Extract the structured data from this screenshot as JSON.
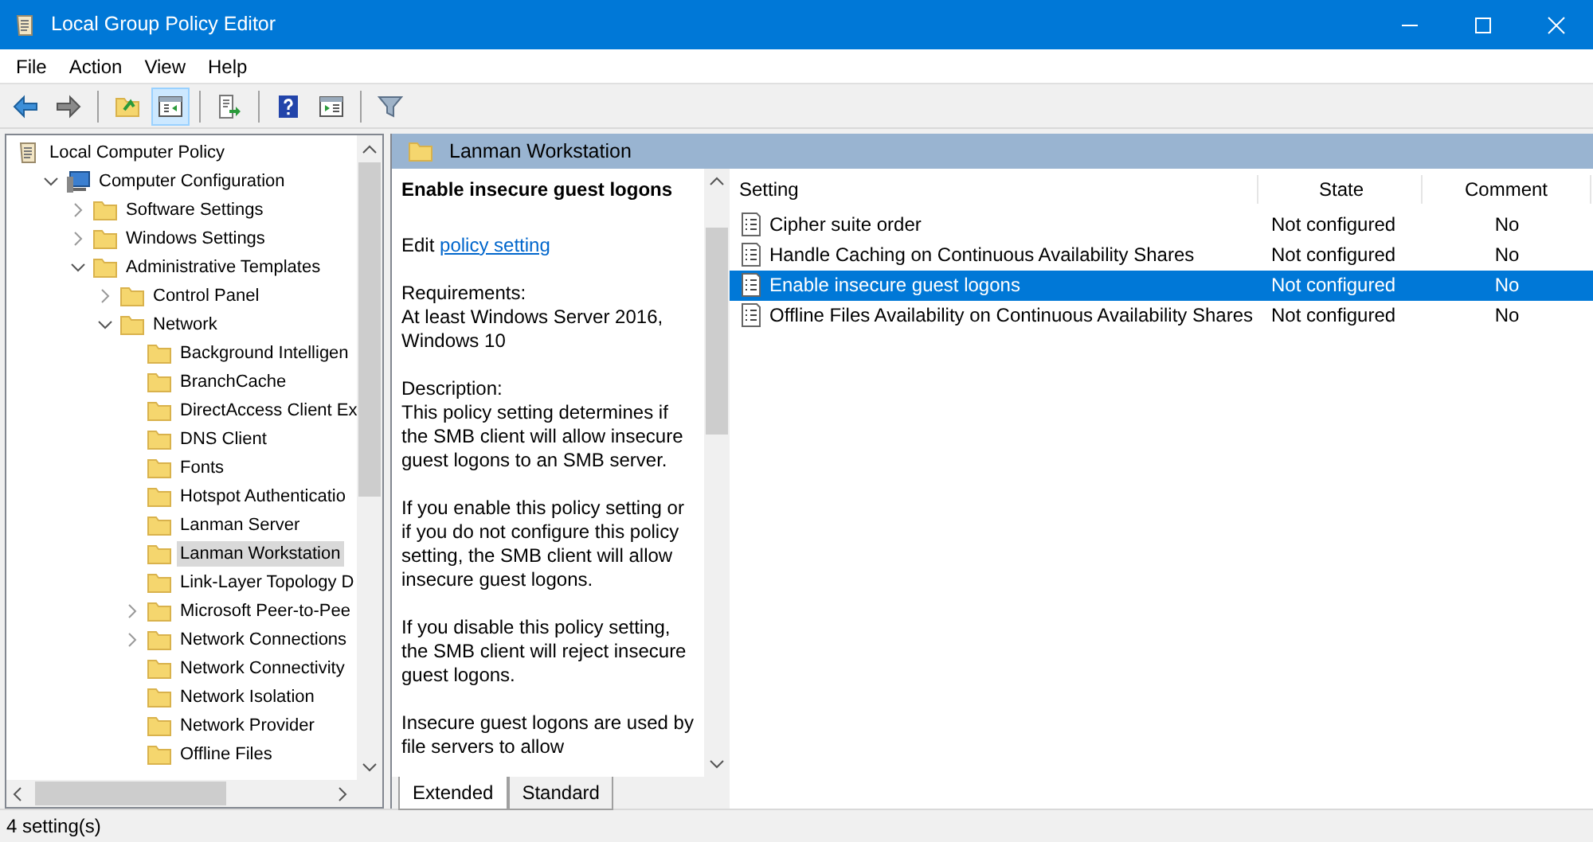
{
  "window": {
    "title": "Local Group Policy Editor"
  },
  "menu": [
    "File",
    "Action",
    "View",
    "Help"
  ],
  "toolbar": [
    {
      "kind": "back",
      "pressed": false
    },
    {
      "kind": "forward",
      "pressed": false
    },
    {
      "kind": "sep"
    },
    {
      "kind": "up",
      "pressed": false
    },
    {
      "kind": "tree",
      "pressed": true
    },
    {
      "kind": "sep"
    },
    {
      "kind": "export",
      "pressed": false
    },
    {
      "kind": "sep"
    },
    {
      "kind": "help",
      "pressed": false
    },
    {
      "kind": "pane",
      "pressed": false
    },
    {
      "kind": "sep"
    },
    {
      "kind": "filter",
      "pressed": false
    }
  ],
  "tree": [
    {
      "label": "Local Computer Policy",
      "kind": "policy",
      "selected": false,
      "children": [
        {
          "label": "Computer Configuration",
          "kind": "computer",
          "expanded": true,
          "selected": false,
          "children": [
            {
              "label": "Software Settings",
              "kind": "folder",
              "expanded": false,
              "selected": false
            },
            {
              "label": "Windows Settings",
              "kind": "folder",
              "expanded": false,
              "selected": false
            },
            {
              "label": "Administrative Templates",
              "kind": "folder",
              "expanded": true,
              "selected": false,
              "children": [
                {
                  "label": "Control Panel",
                  "kind": "folder",
                  "expanded": false,
                  "selected": false
                },
                {
                  "label": "Network",
                  "kind": "folder",
                  "expanded": true,
                  "selected": false,
                  "children": [
                    {
                      "label": "Background Intelligen",
                      "kind": "folder",
                      "selected": false
                    },
                    {
                      "label": "BranchCache",
                      "kind": "folder",
                      "selected": false
                    },
                    {
                      "label": "DirectAccess Client Ex",
                      "kind": "folder",
                      "selected": false
                    },
                    {
                      "label": "DNS Client",
                      "kind": "folder",
                      "selected": false
                    },
                    {
                      "label": "Fonts",
                      "kind": "folder",
                      "selected": false
                    },
                    {
                      "label": "Hotspot Authenticatio",
                      "kind": "folder",
                      "selected": false
                    },
                    {
                      "label": "Lanman Server",
                      "kind": "folder",
                      "selected": false
                    },
                    {
                      "label": "Lanman Workstation",
                      "kind": "folder",
                      "selected": true
                    },
                    {
                      "label": "Link-Layer Topology D",
                      "kind": "folder",
                      "selected": false
                    },
                    {
                      "label": "Microsoft Peer-to-Pee",
                      "kind": "folder",
                      "expanded": false,
                      "selected": false
                    },
                    {
                      "label": "Network Connections",
                      "kind": "folder",
                      "expanded": false,
                      "selected": false
                    },
                    {
                      "label": "Network Connectivity",
                      "kind": "folder",
                      "selected": false
                    },
                    {
                      "label": "Network Isolation",
                      "kind": "folder",
                      "selected": false
                    },
                    {
                      "label": "Network Provider",
                      "kind": "folder",
                      "selected": false
                    },
                    {
                      "label": "Offline Files",
                      "kind": "folder",
                      "selected": false
                    }
                  ]
                }
              ]
            }
          ]
        }
      ]
    }
  ],
  "pane_header": "Lanman Workstation",
  "description": {
    "title": "Enable insecure guest logons",
    "edit_prefix": "Edit",
    "edit_link": "policy setting",
    "paragraphs": [
      "Requirements:\nAt least Windows Server 2016, Windows 10",
      "Description:\nThis policy setting determines if the SMB client will allow insecure guest logons to an SMB server.",
      "If you enable this policy setting or if you do not configure this policy setting, the SMB client will allow insecure guest logons.",
      "If you disable this policy setting, the SMB client will reject insecure guest logons.",
      "Insecure guest logons are used by file servers to allow"
    ]
  },
  "tabs": [
    {
      "label": "Extended",
      "selected": true
    },
    {
      "label": "Standard",
      "selected": false
    }
  ],
  "table": {
    "columns": [
      "Setting",
      "State",
      "Comment"
    ],
    "rows": [
      {
        "setting": "Cipher suite order",
        "state": "Not configured",
        "comment": "No",
        "selected": false
      },
      {
        "setting": "Handle Caching on Continuous Availability Shares",
        "state": "Not configured",
        "comment": "No",
        "selected": false
      },
      {
        "setting": "Enable insecure guest logons",
        "state": "Not configured",
        "comment": "No",
        "selected": true
      },
      {
        "setting": "Offline Files Availability on Continuous Availability Shares",
        "state": "Not configured",
        "comment": "No",
        "selected": false
      }
    ]
  },
  "status_bar": "4 setting(s)"
}
